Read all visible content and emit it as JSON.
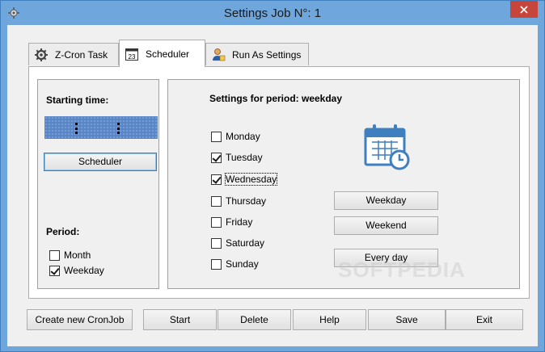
{
  "window": {
    "title": "Settings Job N°: 1"
  },
  "tabs": [
    {
      "label": "Z-Cron Task",
      "icon": "gear-icon"
    },
    {
      "label": "Scheduler",
      "icon": "calendar-23-icon",
      "badge": "23"
    },
    {
      "label": "Run As Settings",
      "icon": "user-icon"
    }
  ],
  "left": {
    "starting_label": "Starting time:",
    "scheduler_button": "Scheduler",
    "period_label": "Period:",
    "periods": [
      {
        "label": "Month",
        "checked": false
      },
      {
        "label": "Weekday",
        "checked": true
      }
    ]
  },
  "right": {
    "heading": "Settings for period: weekday",
    "days": [
      {
        "label": "Monday",
        "checked": false
      },
      {
        "label": "Tuesday",
        "checked": true
      },
      {
        "label": "Wednesday",
        "checked": true
      },
      {
        "label": "Thursday",
        "checked": false
      },
      {
        "label": "Friday",
        "checked": false
      },
      {
        "label": "Saturday",
        "checked": false
      },
      {
        "label": "Sunday",
        "checked": false
      }
    ],
    "buttons": {
      "weekday": "Weekday",
      "weekend": "Weekend",
      "everyday": "Every day"
    }
  },
  "watermark": "SOFTPEDIA",
  "footer": {
    "create": "Create new CronJob",
    "start": "Start",
    "delete": "Delete",
    "help": "Help",
    "save": "Save",
    "exit": "Exit"
  },
  "colors": {
    "titlebar": "#6fa6dc",
    "close": "#c7453b",
    "led": "#5a86c5",
    "calendar": "#3f7fc0"
  }
}
